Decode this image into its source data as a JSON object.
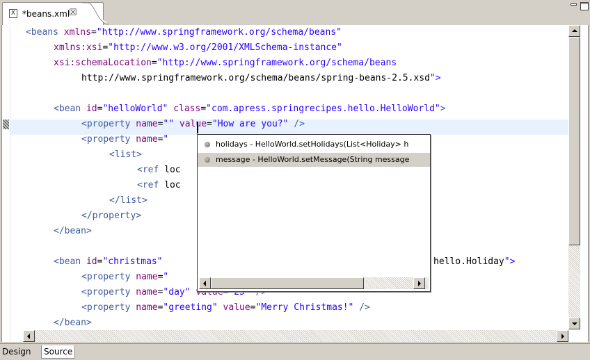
{
  "tab": {
    "title": "*beans.xml",
    "close_glyph": "☒",
    "icon": "xml-file-icon"
  },
  "window_controls": {
    "minimize_icon": "minimize-icon",
    "maximize_icon": "maximize-icon"
  },
  "code_lines": [
    "<beans xmlns=\"http://www.springframework.org/schema/beans\"",
    "xmlns:xsi=\"http://www.w3.org/2001/XMLSchema-instance\"",
    "xsi:schemaLocation=\"http://www.springframework.org/schema/beans",
    "http://www.springframework.org/schema/beans/spring-beans-2.5.xsd\">",
    "",
    "<bean id=\"helloWorld\" class=\"com.apress.springrecipes.hello.HelloWorld\">",
    "<property name=\"\" value=\"How are you?\" />",
    "<property name=\"",
    "<list>",
    "<ref loc",
    "<ref loc",
    "</list>",
    "</property>",
    "</bean>",
    "",
    "<bean id=\"christmas\"",
    "hello.Holiday\">",
    "<property name=\"",
    "<property name=\"day\" value=\"25\" />",
    "<property name=\"greeting\" value=\"Merry Christmas!\" />",
    "</bean>"
  ],
  "content_assist": {
    "items": [
      {
        "label": "holidays - HelloWorld.setHolidays(List<Holiday> h",
        "selected": false
      },
      {
        "label": "message - HelloWorld.setMessage(String message",
        "selected": true
      }
    ]
  },
  "bottom_tabs": [
    {
      "label": "Design",
      "active": false
    },
    {
      "label": "Source",
      "active": true
    }
  ],
  "colors": {
    "tag": "#3f5a9e",
    "attribute": "#7f007f",
    "value": "#2a00ff",
    "current_line": "#e8f2fe",
    "selection": "#d4d0c8"
  }
}
